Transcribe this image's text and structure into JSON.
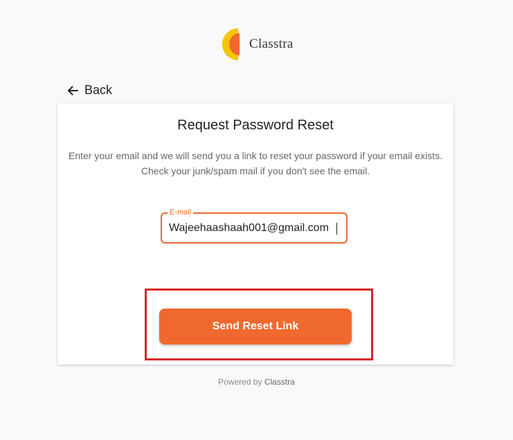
{
  "header": {
    "brand_name": "Classtra",
    "logo_icon": "classtra-logo-icon"
  },
  "nav": {
    "back_label": "Back",
    "back_icon": "arrow-left-icon"
  },
  "card": {
    "title": "Request Password Reset",
    "description": "Enter your email and we will send you a link to reset your password if your email exists. Check your junk/spam mail if you don't see the email.",
    "email_field": {
      "label": "E-mail",
      "value": "Wajeehaashaah001@gmail.com"
    },
    "submit_label": "Send Reset Link"
  },
  "footer": {
    "powered_prefix": "Powered by",
    "powered_brand": "Classtra"
  },
  "colors": {
    "accent": "#f0692e",
    "logo_yellow": "#f5c400",
    "logo_orange": "#f0692e",
    "highlight_box": "#d8232a"
  }
}
